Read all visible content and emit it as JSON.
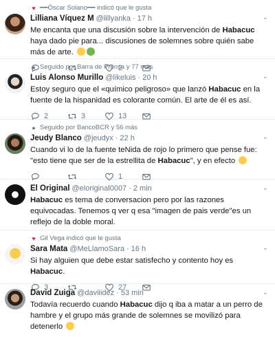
{
  "tweets": [
    {
      "context": "━━Óscar Solano━━ indicó que le gusta",
      "context_icon": "heart-icon",
      "name": "Lilliana Víquez M",
      "handle": "@lillyanka",
      "dot": "·",
      "time": "17 h",
      "text_parts": [
        {
          "t": "Me encanta que una discusión sobre la intervención de "
        },
        {
          "t": "Habacuc",
          "b": true
        },
        {
          "t": " haya dado pie para... discusiones de solemnes sobre quién sabe más de arte."
        }
      ],
      "emojis": [
        "grimace-emoji",
        "nauseated-emoji"
      ],
      "replies": "",
      "retweets": "",
      "likes": "2"
    },
    {
      "context": "Seguido por Barra de Prensa y 77 más",
      "context_icon": "person-icon",
      "name": "Luis Alonso Murillo",
      "handle": "@likeluis",
      "dot": "·",
      "time": "20 h",
      "text_parts": [
        {
          "t": "Estoy seguro que el «químico peligroso» que lanzó "
        },
        {
          "t": "Habacuc",
          "b": true
        },
        {
          "t": " en la fuente de la hispanidad es colorante común. El arte de él es así."
        }
      ],
      "emojis": [],
      "replies": "2",
      "retweets": "3",
      "likes": "13"
    },
    {
      "context": "Seguido por BancoBCR y 56 más",
      "context_icon": "person-icon",
      "name": "Jeudy Blanco",
      "handle": "@jeudyx",
      "dot": "·",
      "time": "22 h",
      "text_parts": [
        {
          "t": "Cuando vi lo de la fuente teNida de rojo lo primero que pense fue: \"esto tiene que ser de la estrellita de "
        },
        {
          "t": "Habacuc",
          "b": true
        },
        {
          "t": "\", y en efecto"
        }
      ],
      "emojis": [
        "relieved-emoji"
      ],
      "replies": "",
      "retweets": "",
      "likes": "1"
    },
    {
      "context": "",
      "context_icon": "",
      "name": "El Original",
      "handle": "@eloriginal0007",
      "dot": "·",
      "time": "2 min",
      "text_parts": [
        {
          "t": "Habacuc",
          "b": true
        },
        {
          "t": " es tema de conversacion pero por las razones equivocadas. Tenemos q ver q esa \"imagen de pais verde\"es un reflejo de la doble moral."
        }
      ],
      "emojis": [],
      "replies": "",
      "retweets": "",
      "likes": ""
    },
    {
      "context": "Gil Vega indicó que le gusta",
      "context_icon": "heart-icon",
      "name": "Sara Mata",
      "handle": "@MeLlamoSara",
      "dot": "·",
      "time": "16 h",
      "text_parts": [
        {
          "t": "Si hay alguien que debe estar satisfecho y contento hoy es "
        },
        {
          "t": "Habacuc",
          "b": true
        },
        {
          "t": "."
        }
      ],
      "emojis": [],
      "replies": "3",
      "retweets": "",
      "likes": "27"
    },
    {
      "context": "",
      "context_icon": "",
      "name": "David Zuiga",
      "handle": "@daviiidez",
      "dot": "·",
      "time": "53 min",
      "text_parts": [
        {
          "t": "Todavía recuerdo cuando "
        },
        {
          "t": "Habacuc",
          "b": true
        },
        {
          "t": " dijo q iba a matar a un perro de hambre y el grupo más grande de solemnes se movilizó para detenerlo"
        }
      ],
      "emojis": [
        "laughing-tears-emoji"
      ],
      "replies": "",
      "retweets": "",
      "likes": ""
    }
  ],
  "colors": {
    "text": "#14171a",
    "muted": "#657786",
    "border": "#e6ecf0",
    "like": "#e0245e",
    "follow_icon": "#17bf63"
  }
}
